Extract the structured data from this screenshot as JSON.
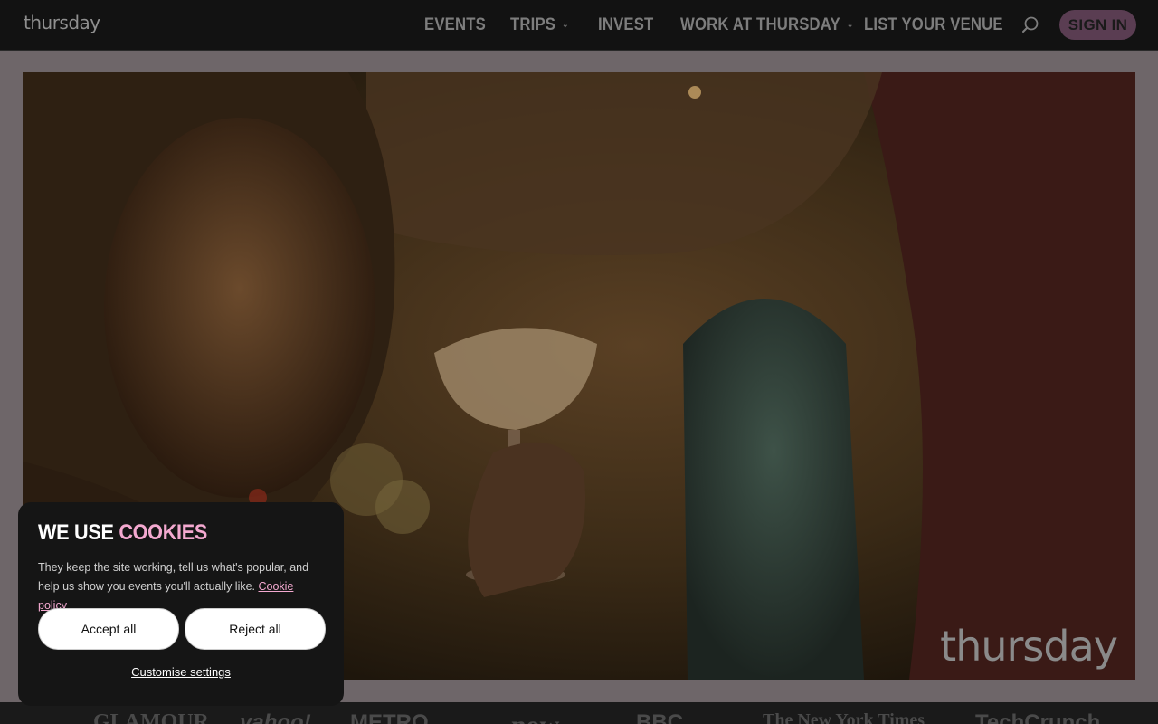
{
  "nav": {
    "logo": "thursday",
    "items": [
      {
        "label": "EVENTS",
        "dropdown": false
      },
      {
        "label": "TRIPS",
        "dropdown": true
      },
      {
        "label": "INVEST",
        "dropdown": false
      },
      {
        "label": "WORK AT THURSDAY",
        "dropdown": true
      },
      {
        "label": "LIST YOUR VENUE",
        "dropdown": false
      }
    ],
    "search_icon": "search-icon",
    "signin_label": "SIGN IN"
  },
  "hero": {
    "watermark": "thursday"
  },
  "cookie": {
    "title_prefix": "WE USE ",
    "title_highlight": "COOKIES",
    "body": "They keep the site working, tell us what's popular, and help us show you events you'll actually like.",
    "link_label": "Cookie policy",
    "accept_label": "Accept all",
    "reject_label": "Reject all",
    "customise_label": "Customise settings"
  },
  "press": {
    "logos": [
      "GLAMOUR",
      "yahoo!",
      "METRO",
      "now",
      "BBC",
      "The New York Times",
      "TechCrunch"
    ]
  },
  "colors": {
    "accent_pink": "#f4a9d0",
    "signin_bg": "#5a3d52",
    "nav_bg": "#121212"
  }
}
